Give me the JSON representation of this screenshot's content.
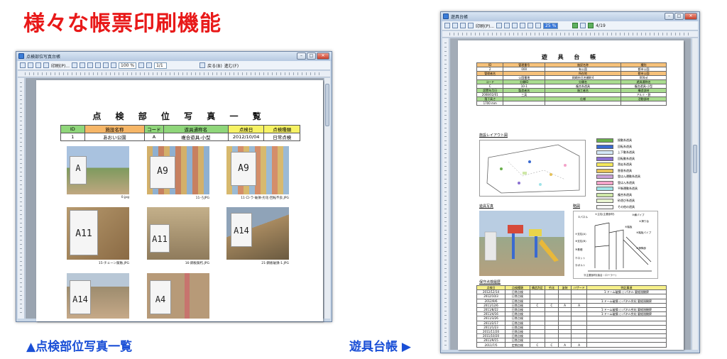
{
  "heading": "様々な帳票印刷機能",
  "captions": {
    "left": "▲点検部位写真一覧",
    "right": "遊具台帳 ▶"
  },
  "colors": {
    "heading": "#e81919",
    "caption": "#1a4fd6",
    "header_orange": "#f6b667",
    "header_yellow": "#f6f264",
    "header_green": "#8fd67a"
  },
  "window1": {
    "title": "点検部位写真台帳",
    "toolbar": {
      "print_label": "印刷(P)...",
      "zoom": "100 %",
      "page": "1/1",
      "back_label": "戻る(B)",
      "next_label": "進む(F)"
    },
    "document": {
      "title": "点 検 部 位 写 真 一 覧",
      "headers": [
        "ID",
        "施設名称",
        "コード",
        "遊具通称名",
        "点検日",
        "点検種類"
      ],
      "row": [
        "1",
        "あおい公園",
        "A",
        "複合遊具-小型",
        "2012/10/04",
        "日常点検"
      ],
      "photos": [
        {
          "board": "A",
          "label": "0.jpg"
        },
        {
          "board": "A9",
          "label": "11-ろJPG"
        },
        {
          "board": "A9",
          "label": "11-ロ-ラ-破損-劣化-回転不良.JPG"
        },
        {
          "board": "A11",
          "label": "15-チェーン腐蝕.JPG"
        },
        {
          "board": "A11",
          "label": "16-鋼板腐朽.JPG"
        },
        {
          "board": "A14",
          "label": "21-鋼板破損-1.JPG"
        },
        {
          "board": "A14",
          "label": ""
        },
        {
          "board": "A4",
          "label": ""
        }
      ]
    }
  },
  "window2": {
    "title": "遊具台帳",
    "toolbar": {
      "print_label": "印刷(P)...",
      "zoom": "25 %",
      "page": "4/19"
    },
    "document": {
      "title": "遊 具 台 帳",
      "info_rows": [
        [
          "ID",
          "管理番号",
          "施設名称",
          "種別"
        ],
        [
          "2",
          "000",
          "有公園",
          "都市公園"
        ],
        [
          "管理者名",
          "",
          "所在地",
          "都市公園"
        ],
        [
          "",
          "公園番地",
          "岡崎市日名橋町4",
          "000㎡"
        ],
        [
          "コード",
          "分類ID",
          "分類名",
          "遊具通称名"
        ],
        [
          "C",
          "10-1",
          "複合系遊具",
          "複合遊具-小型"
        ],
        [
          "設置年月日",
          "製造者名",
          "施工者名",
          "構造部材"
        ],
        [
          "2008/02/01",
          "三英",
          "",
          "アルミ・鉄"
        ],
        [
          "落下高さ",
          "",
          "仕様",
          "活動部材"
        ],
        [
          "1700 mm",
          "",
          "",
          ""
        ]
      ],
      "sections": {
        "layout": "施設レイアウト図",
        "photo": "遊具写真",
        "diagram": "略図",
        "history": "保守点検履歴"
      },
      "legend": [
        "揺動系遊具",
        "回転系遊具",
        "上下動系遊具",
        "回転動系遊具",
        "滑走系遊具",
        "懸垂系遊具",
        "登はん運動系遊具",
        "登はん系遊具",
        "平衡運動系遊具",
        "複合系遊具",
        "砂遊び系遊具",
        "その他の遊具"
      ],
      "legend_colors": [
        "#6ab04c",
        "#3a6ad0",
        "#d4e8f8",
        "#8a6fd0",
        "#f6e95a",
        "#e6c25a",
        "#c9a0d6",
        "#f3a3c9",
        "#9fe3e8",
        "#cfe8a8",
        "#e8f4d0",
        "#f4f4f4"
      ],
      "diagram_labels": [
        "②パネル",
        "①主柱(主要部材)",
        "③横パイプ",
        "④滑り台",
        "⑤踏板",
        "⑥踏板パイプ",
        "⑦支柱(A)",
        "⑧支柱(B)",
        "⑨基礎",
        "⑩滑降部",
        "⑪ネット",
        "⑫ボルト",
        "⑬主要部材(接合・ローラー)"
      ],
      "history_headers": [
        "点検日",
        "点検種類",
        "構造判定",
        "劣化",
        "塗装",
        "ハザード",
        "特記事項"
      ],
      "history_rows": [
        [
          "2012/12/14",
          "日常点検",
          "",
          "",
          "",
          "",
          "1:ドーム破損 ○:パネル 要経過観察"
        ],
        [
          "2012/10/3",
          "日常点検",
          "",
          "",
          "",
          "",
          ""
        ],
        [
          "2012/9/6",
          "日常点検",
          "",
          "",
          "",
          "",
          "1:ドーム破損 ○:パネル劣化 要経過観察"
        ],
        [
          "2011/12/6",
          "日常点検",
          "C",
          "C",
          "A",
          "A",
          ""
        ],
        [
          "2011/8/22",
          "日常点検",
          "",
          "",
          "",
          "",
          "1:ドーム破損 ○:パネル劣化 要経過観察"
        ],
        [
          "2011/4/16",
          "日常点検",
          "",
          "",
          "",
          "",
          "1:ドーム破損 ○:パネル劣化 要経過観察"
        ],
        [
          "2011/3/26",
          "日常点検",
          "",
          "",
          "",
          "",
          ""
        ],
        [
          "2011/2/17",
          "日常点検",
          "",
          "",
          "",
          "",
          ""
        ],
        [
          "2011/1/23",
          "日常点検",
          "",
          "",
          "",
          "",
          ""
        ],
        [
          "2011/11/20",
          "日常点検",
          "",
          "",
          "",
          "",
          ""
        ],
        [
          "2011/10/20",
          "日常点検",
          "",
          "",
          "",
          "",
          ""
        ],
        [
          "2011/9/15",
          "日常点検",
          "",
          "",
          "",
          "",
          ""
        ],
        [
          "2011/7/5",
          "定期点検",
          "C",
          "C",
          "A",
          "A",
          ""
        ]
      ]
    }
  }
}
